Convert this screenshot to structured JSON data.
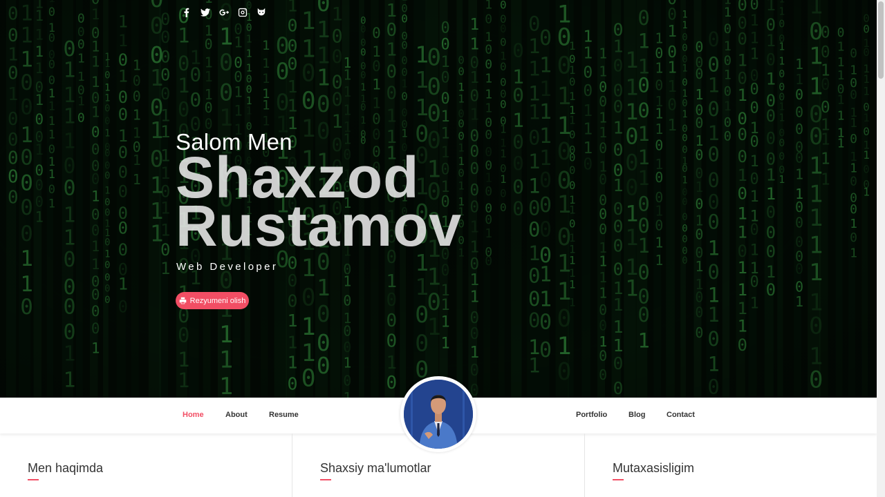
{
  "hero": {
    "greeting": "Salom Men",
    "first_name": "Shaxzod",
    "last_name": "Rustamov",
    "role": "Web Developer",
    "cv_button": "Rezyumeni olish",
    "social_icons": [
      "facebook-icon",
      "twitter-icon",
      "google-plus-icon",
      "instagram-icon",
      "github-icon"
    ]
  },
  "nav": {
    "items": [
      {
        "label": "Home",
        "active": true
      },
      {
        "label": "About"
      },
      {
        "label": "Resume"
      },
      {
        "label": "Portfolio"
      },
      {
        "label": "Blog"
      },
      {
        "label": "Contact"
      }
    ]
  },
  "sections": [
    {
      "title": "Men haqimda"
    },
    {
      "title": "Shaxsiy ma'lumotlar"
    },
    {
      "title": "Mutaxasisligim"
    }
  ],
  "colors": {
    "accent": "#f24e64",
    "hero_bg": "#020a04",
    "matrix_green": "#3fae4a"
  }
}
